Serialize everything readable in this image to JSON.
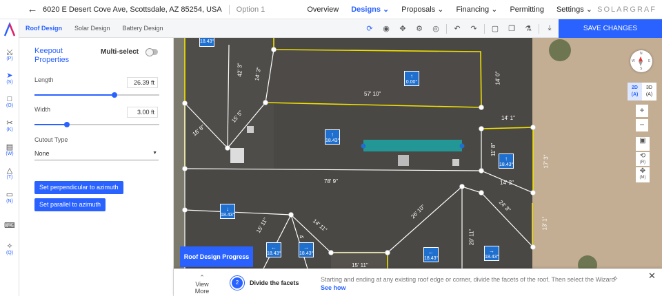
{
  "header": {
    "address": "6020 E Desert Cove Ave, Scottsdale, AZ 85254, USA",
    "option": "Option 1",
    "nav": [
      {
        "label": "Overview",
        "active": false
      },
      {
        "label": "Designs ⌄",
        "active": true
      },
      {
        "label": "Proposals ⌄",
        "active": false
      },
      {
        "label": "Financing ⌄",
        "active": false
      },
      {
        "label": "Permitting",
        "active": false
      },
      {
        "label": "Settings ⌄",
        "active": false
      }
    ],
    "logo": "SOLARGRAF"
  },
  "subbar": {
    "tabs": [
      {
        "label": "Roof Design",
        "active": true
      },
      {
        "label": "Solar Design",
        "active": false
      },
      {
        "label": "Battery Design",
        "active": false
      }
    ],
    "save_label": "SAVE CHANGES"
  },
  "rail": [
    {
      "icon": "pointer-icon",
      "glyph": "⤩",
      "key": "(P)"
    },
    {
      "icon": "select-icon",
      "glyph": "➤",
      "key": "(S)",
      "active": true
    },
    {
      "icon": "obstruction-icon",
      "glyph": "□",
      "key": "(O)"
    },
    {
      "icon": "cut-icon",
      "glyph": "✂",
      "key": "(K)"
    },
    {
      "icon": "window-icon",
      "glyph": "▤",
      "key": "(W)"
    },
    {
      "icon": "tree-icon",
      "glyph": "△",
      "key": "(T)"
    },
    {
      "icon": "ruler-icon",
      "glyph": "▭",
      "key": "(N)"
    },
    {
      "icon": "keyboard-icon",
      "glyph": "⌨",
      "key": ""
    },
    {
      "icon": "wand-icon",
      "glyph": "✧",
      "key": "(Q)"
    }
  ],
  "panel": {
    "title": "Keepout Properties",
    "multiselect": "Multi-select",
    "length_label": "Length",
    "length_value": "26.39 ft",
    "length_fraction": 0.64,
    "width_label": "Width",
    "width_value": "3.00 ft",
    "width_fraction": 0.26,
    "cutout_label": "Cutout Type",
    "cutout_value": "None",
    "perp_button": "Set perpendicular to azimuth",
    "parallel_button": "Set parallel to azimuth"
  },
  "map": {
    "pitches": [
      {
        "deg": "18.43°",
        "arrow": ""
      },
      {
        "deg": "0.00°",
        "arrow": "↑"
      },
      {
        "deg": "18.43°",
        "arrow": "↑"
      },
      {
        "deg": "18.43°",
        "arrow": "↑"
      },
      {
        "deg": "18.43°",
        "arrow": "↓"
      },
      {
        "deg": "18.43°",
        "arrow": "←"
      },
      {
        "deg": "18.43°",
        "arrow": "→"
      },
      {
        "deg": "18.43°",
        "arrow": "←"
      },
      {
        "deg": "18.43°",
        "arrow": "→"
      }
    ],
    "dims": [
      "57' 10\"",
      "78' 9\"",
      "14' 1\"",
      "14' 2\"",
      "11' 8\"",
      "17' 3\"",
      "16' 8\"",
      "42' 3\"",
      "14' 3\"",
      "15' 5\"",
      "26' 10\"",
      "24' 8\"",
      "15' 11\"",
      "14' 11\"",
      "29' 11\"",
      "13' 1\"",
      "15' 11\"",
      "4'",
      "14' 0\""
    ],
    "compass": {
      "n": "N",
      "s": "S",
      "e": "E",
      "w": "W"
    },
    "view": {
      "two_d": "2D",
      "two_d_key": "(A)",
      "three_d": "3D",
      "three_d_key": "(A)"
    },
    "zoom_in": "+",
    "zoom_out": "−",
    "tool_r": "(R)",
    "tool_m": "(M)"
  },
  "progress": {
    "tab_label": "Roof Design Progress",
    "view_more": "View More",
    "step_number": "2",
    "step_title": "Divide the facets",
    "step_desc": "Starting and ending at any existing roof edge or corner, divide the facets of the roof. Then select the Wizard",
    "see_how": "See how"
  }
}
